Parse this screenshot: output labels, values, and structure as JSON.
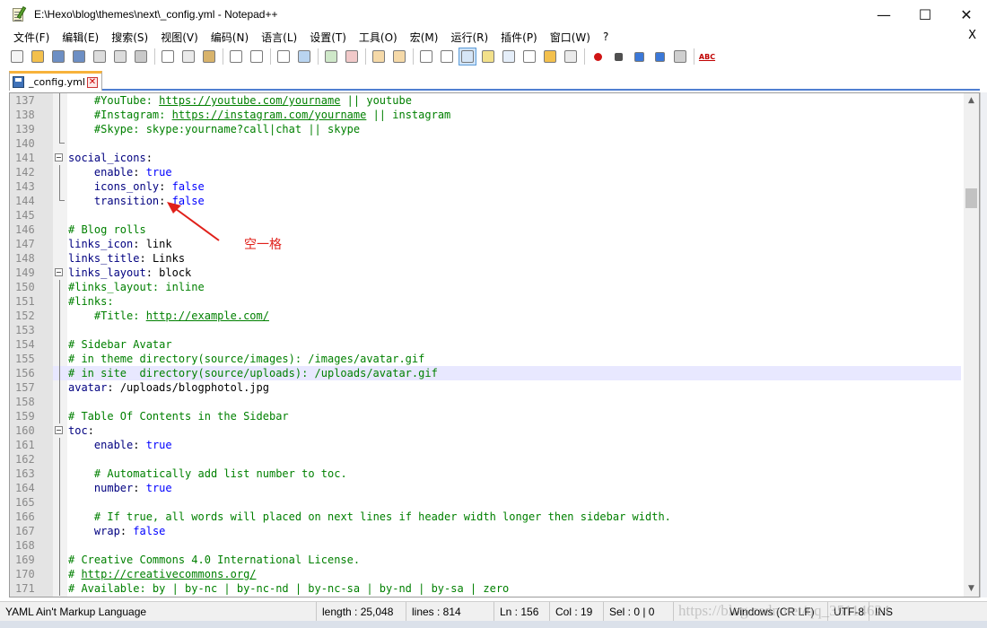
{
  "window": {
    "title": "E:\\Hexo\\blog\\themes\\next\\_config.yml - Notepad++",
    "minimize": "—",
    "maximize": "☐",
    "close": "✕"
  },
  "menu": {
    "items": [
      "文件(F)",
      "编辑(E)",
      "搜索(S)",
      "视图(V)",
      "编码(N)",
      "语言(L)",
      "设置(T)",
      "工具(O)",
      "宏(M)",
      "运行(R)",
      "插件(P)",
      "窗口(W)",
      "?"
    ],
    "close": "X"
  },
  "toolbar": {
    "spell_label": "ABC"
  },
  "tab": {
    "label": "_config.yml",
    "close": "✕"
  },
  "editor": {
    "current_line": 156,
    "lines": [
      {
        "n": "137",
        "text": "    #YouTube: https://youtube.com/yourname || youtube"
      },
      {
        "n": "138",
        "text": "    #Instagram: https://instagram.com/yourname || instagram"
      },
      {
        "n": "139",
        "text": "    #Skype: skype:yourname?call|chat || skype"
      },
      {
        "n": "140",
        "text": ""
      },
      {
        "n": "141",
        "text": "social_icons:"
      },
      {
        "n": "142",
        "text": "    enable: true"
      },
      {
        "n": "143",
        "text": "    icons_only: false"
      },
      {
        "n": "144",
        "text": "    transition: false"
      },
      {
        "n": "145",
        "text": ""
      },
      {
        "n": "146",
        "text": "# Blog rolls"
      },
      {
        "n": "147",
        "text": "links_icon: link"
      },
      {
        "n": "148",
        "text": "links_title: Links"
      },
      {
        "n": "149",
        "text": "links_layout: block"
      },
      {
        "n": "150",
        "text": "#links_layout: inline"
      },
      {
        "n": "151",
        "text": "#links:"
      },
      {
        "n": "152",
        "text": "    #Title: http://example.com/"
      },
      {
        "n": "153",
        "text": ""
      },
      {
        "n": "154",
        "text": "# Sidebar Avatar"
      },
      {
        "n": "155",
        "text": "# in theme directory(source/images): /images/avatar.gif"
      },
      {
        "n": "156",
        "text": "# in site  directory(source/uploads): /uploads/avatar.gif"
      },
      {
        "n": "157",
        "text": "avatar: /uploads/blogphotol.jpg"
      },
      {
        "n": "158",
        "text": ""
      },
      {
        "n": "159",
        "text": "# Table Of Contents in the Sidebar"
      },
      {
        "n": "160",
        "text": "toc:"
      },
      {
        "n": "161",
        "text": "    enable: true"
      },
      {
        "n": "162",
        "text": ""
      },
      {
        "n": "163",
        "text": "    # Automatically add list number to toc."
      },
      {
        "n": "164",
        "text": "    number: true"
      },
      {
        "n": "165",
        "text": ""
      },
      {
        "n": "166",
        "text": "    # If true, all words will placed on next lines if header width longer then sidebar width."
      },
      {
        "n": "167",
        "text": "    wrap: false"
      },
      {
        "n": "168",
        "text": ""
      },
      {
        "n": "169",
        "text": "# Creative Commons 4.0 International License."
      },
      {
        "n": "170",
        "text": "# http://creativecommons.org/"
      },
      {
        "n": "171",
        "text": "# Available: by | by-nc | by-nc-nd | by-nc-sa | by-nd | by-sa | zero"
      }
    ]
  },
  "annotation": {
    "text": "空一格",
    "color": "#e0201a"
  },
  "status": {
    "language": "YAML Ain't Markup Language",
    "length": "length : 25,048",
    "lines": "lines : 814",
    "ln": "Ln : 156",
    "col": "Col : 19",
    "sel": "Sel : 0 | 0",
    "eol": "Windows (CR LF)",
    "encoding": "UTF-8",
    "mode": "INS"
  },
  "watermark": "https://blog.csdn.net/qq_35114624"
}
